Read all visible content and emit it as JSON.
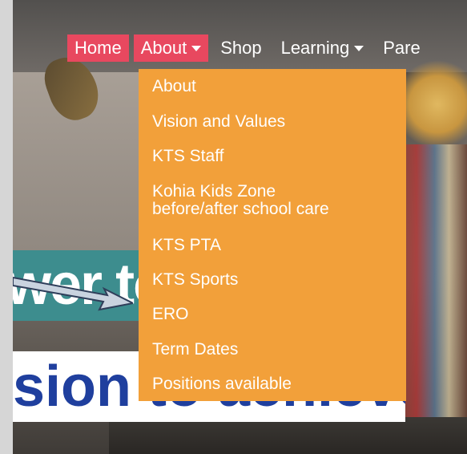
{
  "nav": {
    "items": [
      {
        "label": "Home",
        "active": true,
        "has_caret": false
      },
      {
        "label": "About",
        "active": true,
        "has_caret": true
      },
      {
        "label": "Shop",
        "active": false,
        "has_caret": false
      },
      {
        "label": "Learning",
        "active": false,
        "has_caret": true
      },
      {
        "label": "Pare",
        "active": false,
        "has_caret": false
      }
    ]
  },
  "dropdown": {
    "items": [
      {
        "label": "About"
      },
      {
        "label": "Vision and Values"
      },
      {
        "label": "KTS Staff"
      },
      {
        "label": "Kohia Kids Zone",
        "label2": "before/after school care"
      },
      {
        "label": "KTS PTA"
      },
      {
        "label": "KTS Sports"
      },
      {
        "label": "ERO"
      },
      {
        "label": "Term Dates"
      },
      {
        "label": "Positions available"
      }
    ]
  },
  "hero": {
    "teal_banner_text": "wer to",
    "white_banner_text": "sion to achieve"
  },
  "colors": {
    "nav_active_bg": "#e8485f",
    "dropdown_bg": "#f2a03a",
    "teal_banner": "#3d8d8e",
    "white_banner_text": "#1f3f9e"
  }
}
